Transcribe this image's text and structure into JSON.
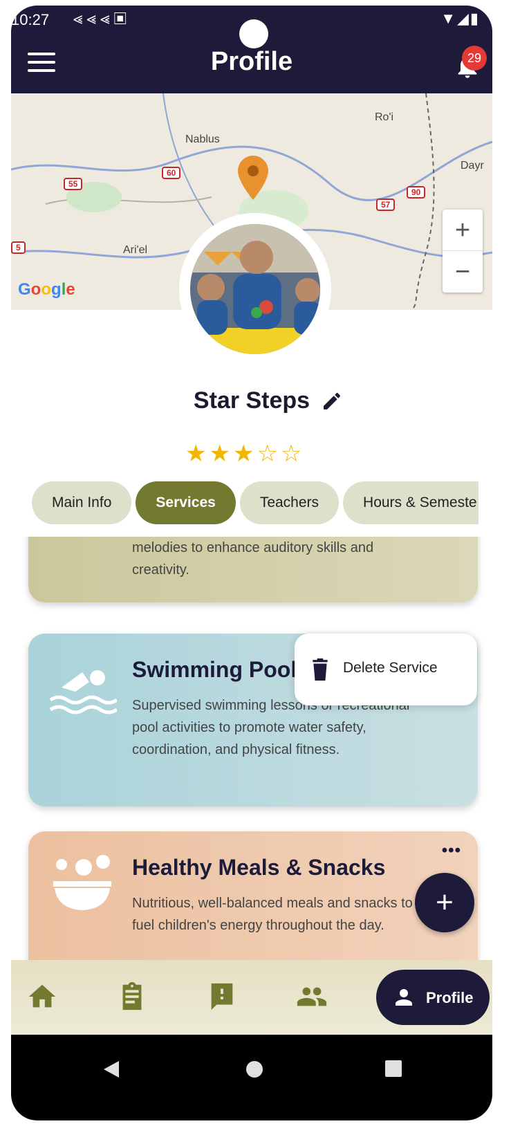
{
  "status_bar": {
    "time": "10:27",
    "icons": [
      "arrow-left-icon",
      "arrow-left-icon",
      "arrow-left-icon",
      "app-a-icon"
    ],
    "right_icons": [
      "wifi-icon",
      "signal-icon",
      "battery-icon"
    ]
  },
  "app_bar": {
    "title": "Profile",
    "notification_count": "29"
  },
  "map": {
    "labels": [
      "Nablus",
      "Ro'i",
      "Ari'el",
      "Dayr"
    ],
    "road_numbers": [
      "55",
      "60",
      "90",
      "57",
      "5"
    ],
    "google_logo": "Google",
    "zoom_in": "+",
    "zoom_out": "−"
  },
  "profile": {
    "name": "Star Steps",
    "rating": 3,
    "rating_max": 5,
    "stars_display": "★★★☆☆"
  },
  "tabs": [
    {
      "label": "Main Info",
      "active": false
    },
    {
      "label": "Services",
      "active": true
    },
    {
      "label": "Teachers",
      "active": false
    },
    {
      "label": "Hours & Semeste",
      "active": false
    }
  ],
  "services": [
    {
      "title": "",
      "description_line1": "melodies to enhance auditory skills and",
      "description_line2": "creativity.",
      "icon": "music-icon"
    },
    {
      "title": "Swimming Pool",
      "description_line1": "Supervised swimming lessons or recreational",
      "description_line2": "pool activities to promote water safety,",
      "description_line3": "coordination, and physical fitness.",
      "icon": "swimmer-icon"
    },
    {
      "title": "Healthy Meals & Snacks",
      "description_line1": "Nutritious, well-balanced meals and snacks to",
      "description_line2": "fuel children's energy throughout the day.",
      "icon": "meal-bowl-icon",
      "more": "•••"
    }
  ],
  "popup_menu": {
    "delete_label": "Delete Service"
  },
  "fab": {
    "label": "+"
  },
  "bottom_nav": {
    "items": [
      "home-icon",
      "clipboard-icon",
      "feedback-icon",
      "group-icon"
    ],
    "active_label": "Profile"
  },
  "colors": {
    "primary_dark": "#1e1b3a",
    "accent_olive": "#737a30",
    "tab_bg": "#dfe0cb",
    "star": "#f2b600",
    "badge": "#e53935"
  }
}
